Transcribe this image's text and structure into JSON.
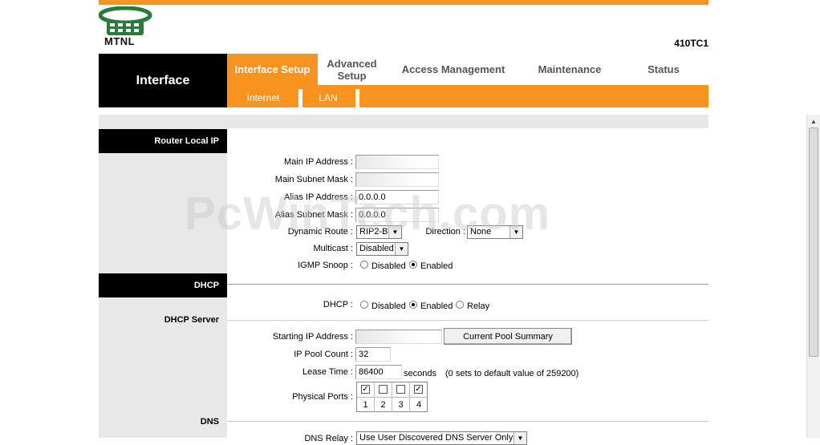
{
  "brand": {
    "logo_text": "MTNL",
    "model": "410TC1"
  },
  "nav": {
    "interface_label": "Interface",
    "tabs": [
      {
        "label": "Interface Setup",
        "active": true
      },
      {
        "label": "Advanced Setup"
      },
      {
        "label": "Access Management"
      },
      {
        "label": "Maintenance"
      },
      {
        "label": "Status"
      }
    ],
    "subtabs": [
      "Internet",
      "LAN"
    ]
  },
  "sections": {
    "router_local_ip": "Router Local IP",
    "dhcp": "DHCP",
    "dhcp_server": "DHCP Server",
    "dns": "DNS"
  },
  "router": {
    "main_ip_label": "Main IP Address :",
    "main_ip_value": "",
    "main_mask_label": "Main Subnet Mask :",
    "main_mask_value": "",
    "alias_ip_label": "Alias IP Address :",
    "alias_ip_value": "0.0.0.0",
    "alias_mask_label": "Alias Subnet Mask :",
    "alias_mask_value": "0.0.0.0",
    "dynamic_route_label": "Dynamic Route :",
    "dynamic_route_value": "RIP2-B",
    "direction_label": "Direction :",
    "direction_value": "None",
    "multicast_label": "Multicast :",
    "multicast_value": "Disabled",
    "igmp_label": "IGMP Snoop :",
    "igmp_options": [
      "Disabled",
      "Enabled"
    ],
    "igmp_selected": "Enabled"
  },
  "dhcp": {
    "mode_label": "DHCP :",
    "mode_options": [
      "Disabled",
      "Enabled",
      "Relay"
    ],
    "mode_selected": "Enabled",
    "start_ip_label": "Starting IP Address :",
    "start_ip_value": "",
    "pool_button": "Current Pool Summary",
    "pool_count_label": "IP Pool Count :",
    "pool_count_value": "32",
    "lease_label": "Lease Time :",
    "lease_value": "86400",
    "lease_unit": "seconds",
    "lease_note": "(0 sets to default value of 259200)",
    "ports_label": "Physical Ports :",
    "ports": [
      {
        "num": "1",
        "checked": true
      },
      {
        "num": "2",
        "checked": false
      },
      {
        "num": "3",
        "checked": false
      },
      {
        "num": "4",
        "checked": true
      }
    ]
  },
  "dns": {
    "relay_label": "DNS Relay :",
    "relay_value": "Use User Discovered DNS Server Only"
  },
  "watermark": "PcWinTech.com",
  "colors": {
    "accent": "#f7931e",
    "header_black": "#000000",
    "panel_gray": "#e8e8e8"
  }
}
